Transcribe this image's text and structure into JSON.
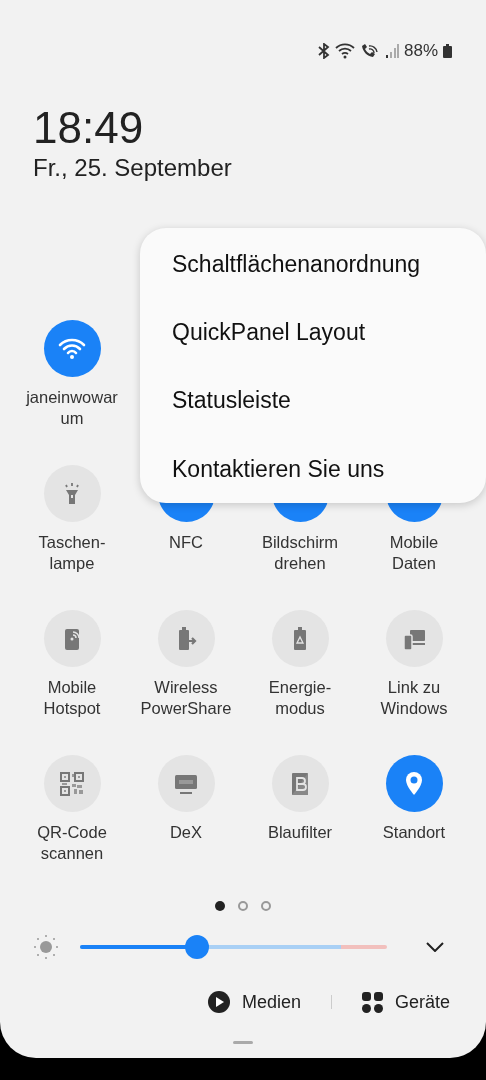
{
  "status_bar": {
    "battery": "88%"
  },
  "clock": {
    "time": "18:49",
    "date": "Fr., 25. September"
  },
  "menu": {
    "items": [
      "Schaltflächenanordnung",
      "QuickPanel Layout",
      "Statusleiste",
      "Kontaktieren Sie uns"
    ]
  },
  "tile_rows": [
    [
      {
        "label": [
          "janeinwowar",
          "um"
        ],
        "on": true
      }
    ],
    [
      {
        "label": [
          "Taschen-",
          "lampe"
        ],
        "on": false
      },
      {
        "label": [
          "NFC"
        ],
        "on": true
      },
      {
        "label": [
          "Bildschirm",
          "drehen"
        ],
        "on": true
      },
      {
        "label": [
          "Mobile",
          "Daten"
        ],
        "on": true
      }
    ],
    [
      {
        "label": [
          "Mobile",
          "Hotspot"
        ],
        "on": false
      },
      {
        "label": [
          "Wireless",
          "PowerShare"
        ],
        "on": false
      },
      {
        "label": [
          "Energie-",
          "modus"
        ],
        "on": false
      },
      {
        "label": [
          "Link zu",
          "Windows"
        ],
        "on": false
      }
    ],
    [
      {
        "label": [
          "QR-Code",
          "scannen"
        ],
        "on": false
      },
      {
        "label": [
          "DeX"
        ],
        "on": false
      },
      {
        "label": [
          "Blaufilter"
        ],
        "on": false
      },
      {
        "label": [
          "Standort"
        ],
        "on": true
      }
    ]
  ],
  "pages": [
    {
      "selected": true
    },
    {
      "selected": false
    },
    {
      "selected": false
    }
  ],
  "brightness": {
    "level": 0.38
  },
  "bottom": {
    "media": "Medien",
    "devices": "Geräte"
  }
}
